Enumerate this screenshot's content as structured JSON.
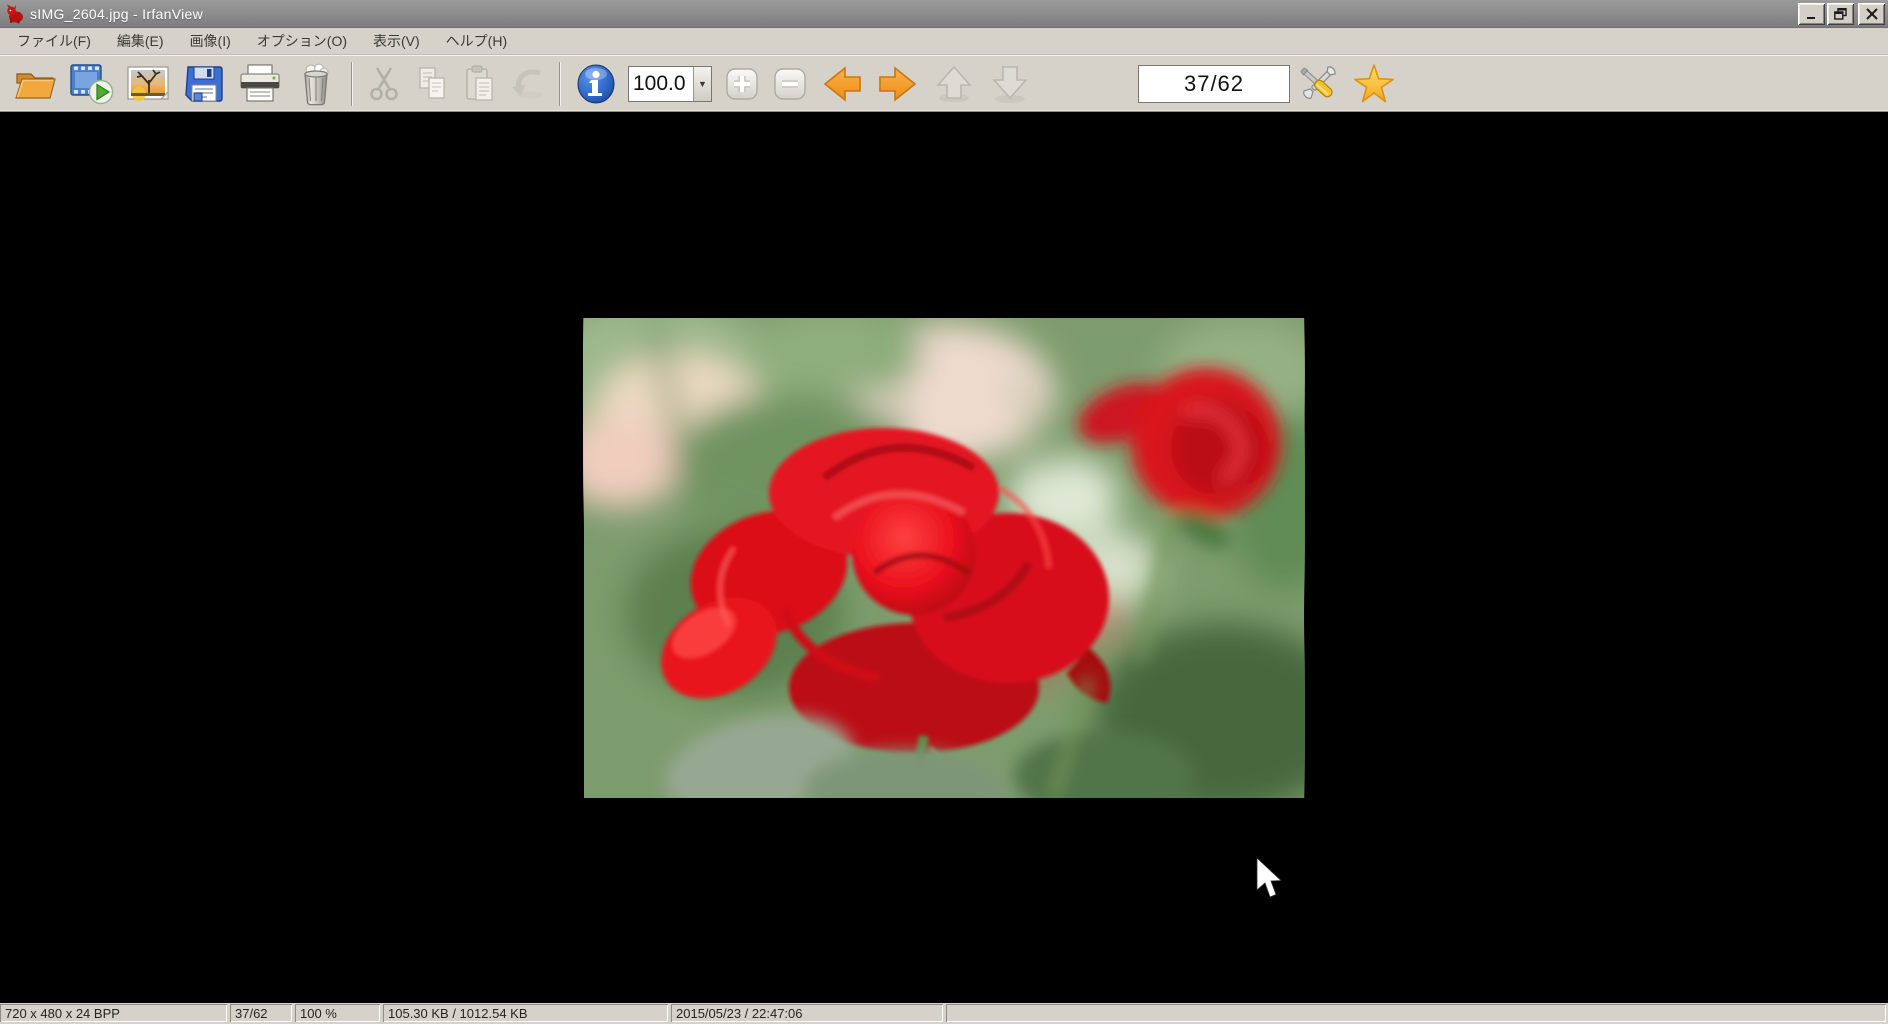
{
  "window": {
    "title": "sIMG_2604.jpg - IrfanView",
    "controls": {
      "minimize": "minimize",
      "restore": "restore",
      "close": "close"
    }
  },
  "menubar": {
    "items": [
      {
        "label": "ファイル(F)"
      },
      {
        "label": "編集(E)"
      },
      {
        "label": "画像(I)"
      },
      {
        "label": "オプション(O)"
      },
      {
        "label": "表示(V)"
      },
      {
        "label": "ヘルプ(H)"
      }
    ]
  },
  "toolbar": {
    "zoom": {
      "value": "100.0"
    },
    "page_indicator": {
      "value": "37/62"
    },
    "buttons": [
      {
        "name": "open",
        "icon": "folder-open-icon",
        "enabled": true
      },
      {
        "name": "slideshow",
        "icon": "slideshow-icon",
        "enabled": true
      },
      {
        "name": "thumbnails",
        "icon": "thumbnails-icon",
        "enabled": true
      },
      {
        "name": "save",
        "icon": "save-icon",
        "enabled": true
      },
      {
        "name": "print",
        "icon": "print-icon",
        "enabled": true
      },
      {
        "name": "delete",
        "icon": "delete-icon",
        "enabled": true
      },
      {
        "name": "cut",
        "icon": "cut-icon",
        "enabled": false
      },
      {
        "name": "copy",
        "icon": "copy-icon",
        "enabled": false
      },
      {
        "name": "paste",
        "icon": "paste-icon",
        "enabled": false
      },
      {
        "name": "undo",
        "icon": "undo-icon",
        "enabled": false
      },
      {
        "name": "info",
        "icon": "info-icon",
        "enabled": true
      },
      {
        "name": "zoom-in",
        "icon": "plus-icon",
        "enabled": true
      },
      {
        "name": "zoom-out",
        "icon": "minus-icon",
        "enabled": true
      },
      {
        "name": "previous-image",
        "icon": "arrow-left-icon",
        "enabled": true
      },
      {
        "name": "next-image",
        "icon": "arrow-right-icon",
        "enabled": true
      },
      {
        "name": "first-image",
        "icon": "arrow-up-icon",
        "enabled": false
      },
      {
        "name": "last-image",
        "icon": "arrow-down-icon",
        "enabled": false
      },
      {
        "name": "properties",
        "icon": "tools-icon",
        "enabled": true
      },
      {
        "name": "favorites",
        "icon": "star-icon",
        "enabled": true
      }
    ]
  },
  "viewer": {
    "photo_subject": "red rose in focus with blurred second red rose and green garden background"
  },
  "statusbar": {
    "dimensions": "720 x 480 x 24 BPP",
    "position": "37/62",
    "zoom_percent": "100 %",
    "file_size": "105.30 KB / 1012.54 KB",
    "datetime": "2015/05/23 / 22:47:06"
  },
  "colors": {
    "chrome_bg": "#d6d2c9",
    "titlebar": "#8a8a8a",
    "canvas": "#000000",
    "arrow_orange": "#f59b2c",
    "star_yellow": "#f7b733",
    "info_blue": "#2b66c4",
    "rose_red": "#e01218"
  }
}
